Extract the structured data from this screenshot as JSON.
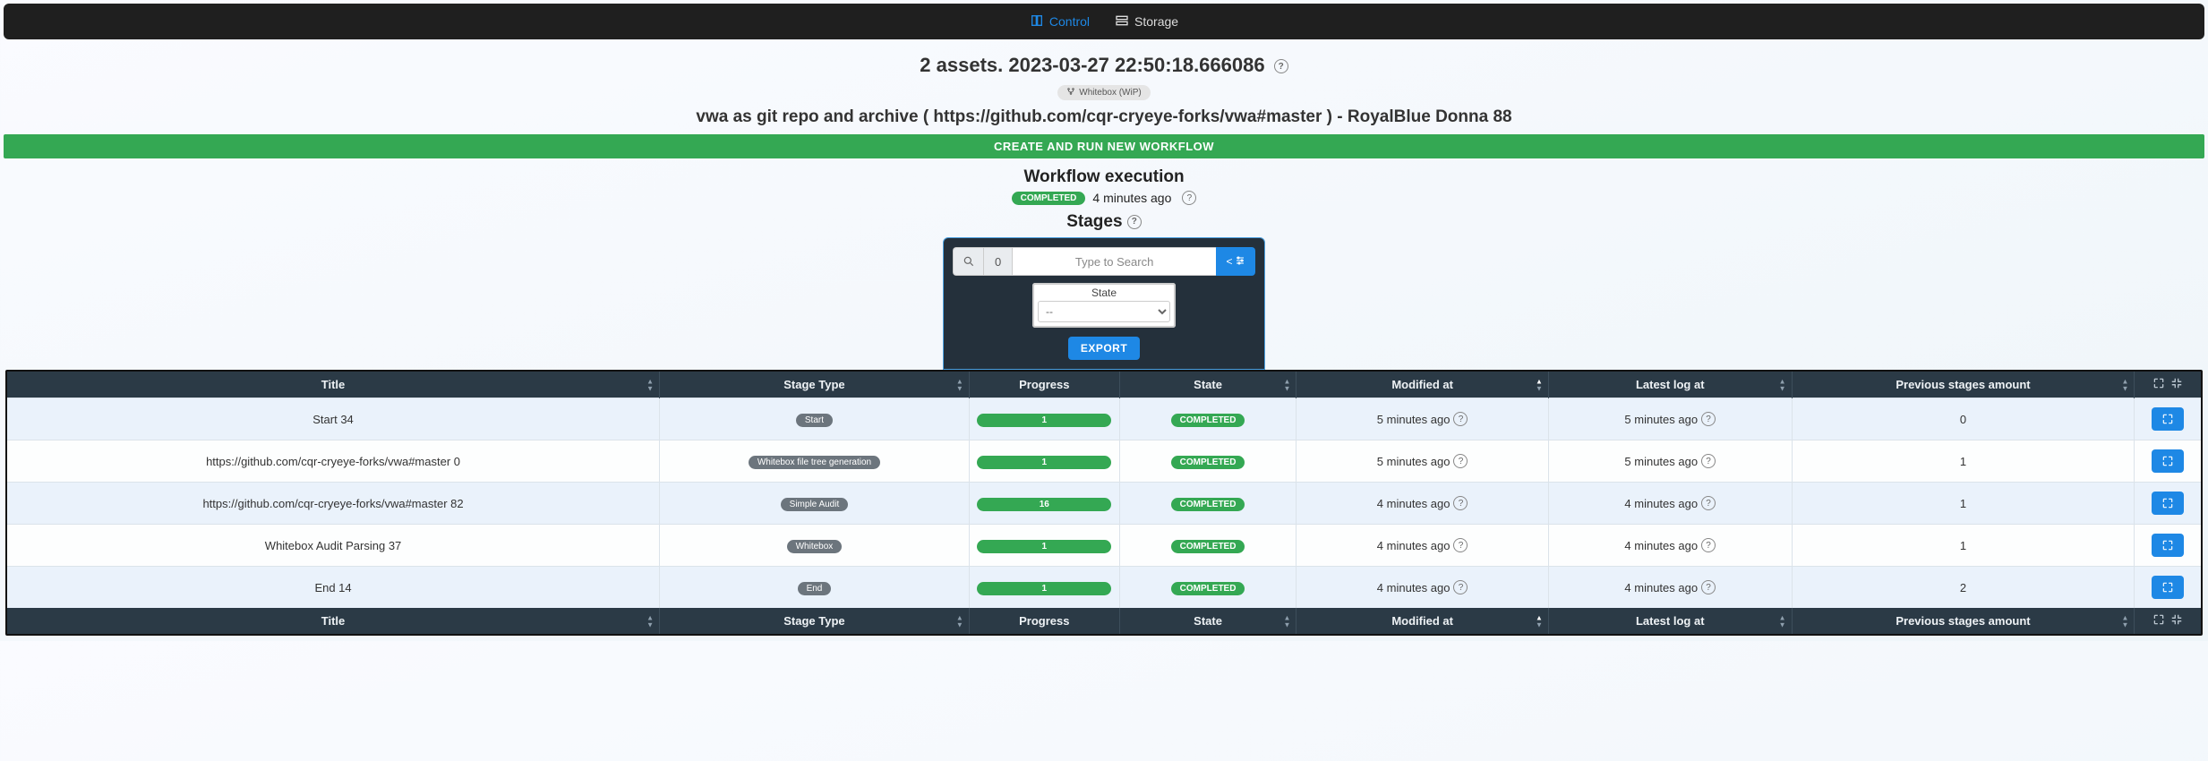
{
  "nav": {
    "control": "Control",
    "storage": "Storage"
  },
  "header": {
    "assets_line": "2 assets. 2023-03-27 22:50:18.666086",
    "wip_chip": "Whitebox (WiP)",
    "subtitle": "vwa as git repo and archive ( https://github.com/cqr-cryeye-forks/vwa#master ) - RoyalBlue Donna 88"
  },
  "actions": {
    "create_workflow": "CREATE AND RUN NEW WORKFLOW",
    "export": "EXPORT"
  },
  "workflow": {
    "title": "Workflow execution",
    "status": "COMPLETED",
    "modified": "4 minutes ago"
  },
  "stages": {
    "title": "Stages",
    "filter": {
      "count": "0",
      "placeholder": "Type to Search",
      "toggle_label": "<",
      "state_label": "State",
      "state_value": "--"
    },
    "columns": {
      "title": "Title",
      "stage_type": "Stage Type",
      "progress": "Progress",
      "state": "State",
      "modified": "Modified at",
      "latest_log": "Latest log at",
      "prev": "Previous stages amount"
    },
    "rows": [
      {
        "title": "Start 34",
        "type": "Start",
        "progress": "1",
        "state": "COMPLETED",
        "modified": "5 minutes ago",
        "log": "5 minutes ago",
        "prev": "0"
      },
      {
        "title": "https://github.com/cqr-cryeye-forks/vwa#master 0",
        "type": "Whitebox file tree generation",
        "progress": "1",
        "state": "COMPLETED",
        "modified": "5 minutes ago",
        "log": "5 minutes ago",
        "prev": "1"
      },
      {
        "title": "https://github.com/cqr-cryeye-forks/vwa#master 82",
        "type": "Simple Audit",
        "progress": "16",
        "state": "COMPLETED",
        "modified": "4 minutes ago",
        "log": "4 minutes ago",
        "prev": "1"
      },
      {
        "title": "Whitebox Audit Parsing 37",
        "type": "Whitebox",
        "progress": "1",
        "state": "COMPLETED",
        "modified": "4 minutes ago",
        "log": "4 minutes ago",
        "prev": "1"
      },
      {
        "title": "End 14",
        "type": "End",
        "progress": "1",
        "state": "COMPLETED",
        "modified": "4 minutes ago",
        "log": "4 minutes ago",
        "prev": "2"
      }
    ]
  }
}
